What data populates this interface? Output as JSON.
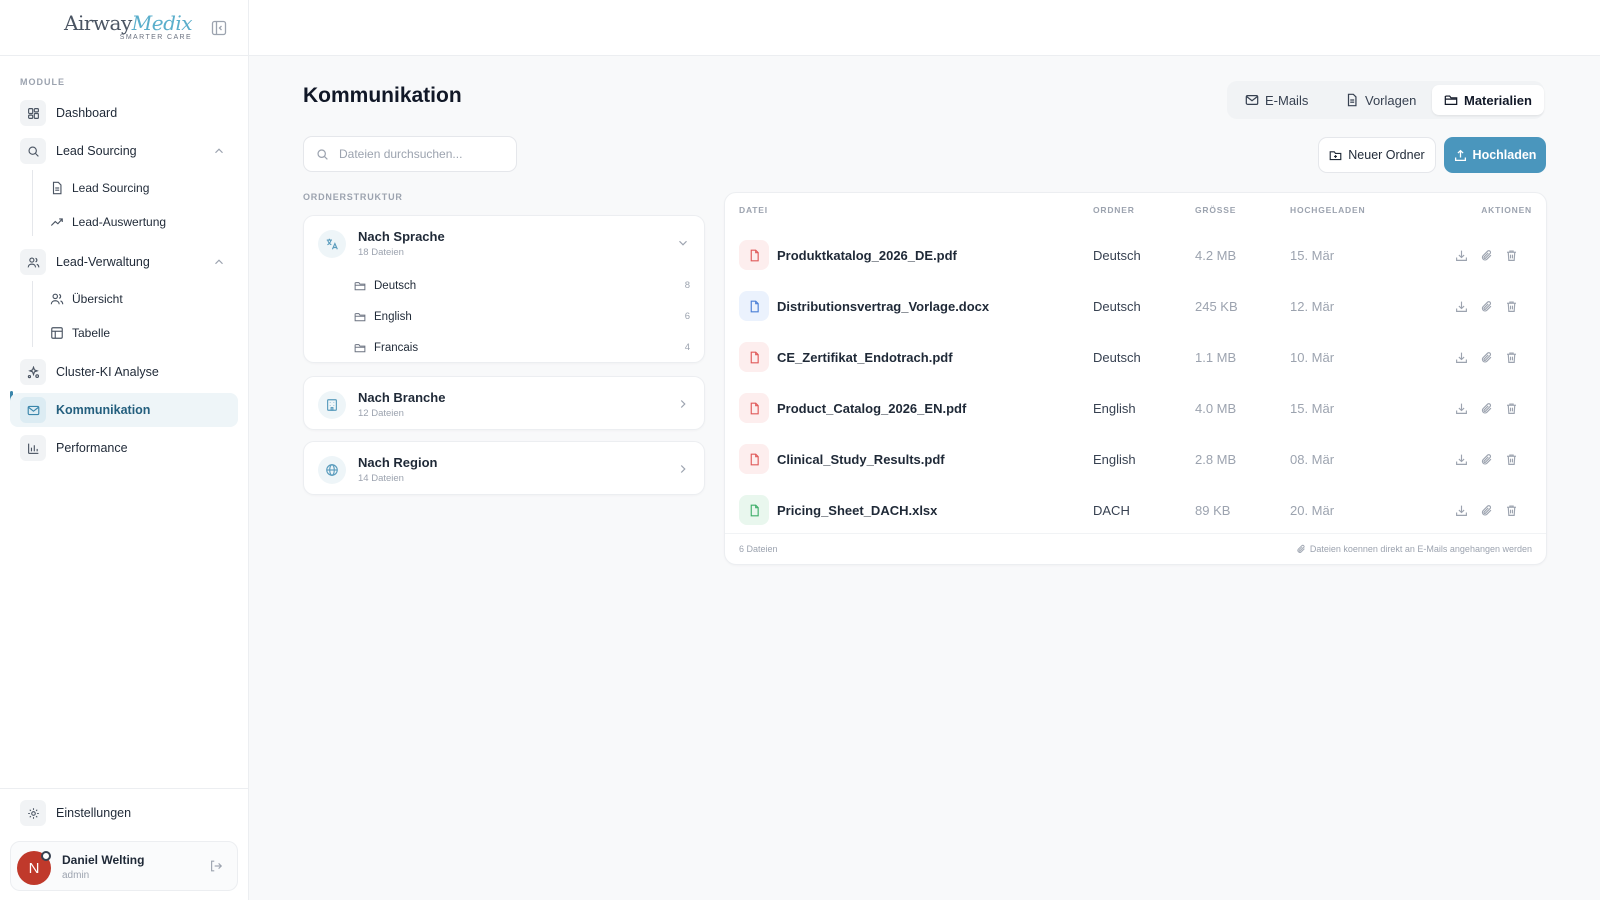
{
  "brand": {
    "name_part1": "Airway",
    "name_part2": "Medix",
    "tagline": "SMARTER CARE"
  },
  "sidebar": {
    "section_label": "MODULE",
    "items": [
      {
        "label": "Dashboard",
        "icon": "dashboard-icon"
      },
      {
        "label": "Lead Sourcing",
        "icon": "search-icon",
        "expanded": true,
        "children": [
          {
            "label": "Lead Sourcing",
            "icon": "document-icon"
          },
          {
            "label": "Lead-Auswertung",
            "icon": "trend-icon"
          }
        ]
      },
      {
        "label": "Lead-Verwaltung",
        "icon": "users-icon",
        "expanded": true,
        "children": [
          {
            "label": "Übersicht",
            "icon": "users-icon"
          },
          {
            "label": "Tabelle",
            "icon": "table-icon"
          }
        ]
      },
      {
        "label": "Cluster-KI Analyse",
        "icon": "cluster-icon"
      },
      {
        "label": "Kommunikation",
        "icon": "mail-icon",
        "active": true
      },
      {
        "label": "Performance",
        "icon": "bar-chart-icon"
      }
    ],
    "settings_label": "Einstellungen",
    "user": {
      "initial": "N",
      "name": "Daniel Welting",
      "role": "admin"
    }
  },
  "main": {
    "title": "Kommunikation",
    "tabs": [
      {
        "label": "E-Mails",
        "icon": "mail-icon",
        "active": false
      },
      {
        "label": "Vorlagen",
        "icon": "document-icon",
        "active": false
      },
      {
        "label": "Materialien",
        "icon": "folder-icon",
        "active": true
      }
    ],
    "search": {
      "placeholder": "Dateien durchsuchen...",
      "value": ""
    },
    "new_folder_label": "Neuer Ordner",
    "upload_label": "Hochladen",
    "folder_structure_label": "ORDNERSTRUKTUR",
    "folders": [
      {
        "title": "Nach Sprache",
        "subtitle": "18 Dateien",
        "icon": "translate-icon",
        "expanded": true,
        "children": [
          {
            "label": "Deutsch",
            "count": "8"
          },
          {
            "label": "English",
            "count": "6"
          },
          {
            "label": "Francais",
            "count": "4"
          }
        ]
      },
      {
        "title": "Nach Branche",
        "subtitle": "12 Dateien",
        "icon": "building-icon",
        "expanded": false
      },
      {
        "title": "Nach Region",
        "subtitle": "14 Dateien",
        "icon": "globe-icon",
        "expanded": false
      }
    ],
    "table": {
      "headers": {
        "file": "DATEI",
        "folder": "ORDNER",
        "size": "GRÖSSE",
        "uploaded": "HOCHGELADEN",
        "actions": "AKTIONEN"
      },
      "rows": [
        {
          "name": "Produktkatalog_2026_DE.pdf",
          "type": "pdf",
          "folder": "Deutsch",
          "size": "4.2 MB",
          "date": "15. Mär"
        },
        {
          "name": "Distributionsvertrag_Vorlage.docx",
          "type": "doc",
          "folder": "Deutsch",
          "size": "245 KB",
          "date": "12. Mär"
        },
        {
          "name": "CE_Zertifikat_Endotrach.pdf",
          "type": "pdf",
          "folder": "Deutsch",
          "size": "1.1 MB",
          "date": "10. Mär"
        },
        {
          "name": "Product_Catalog_2026_EN.pdf",
          "type": "pdf",
          "folder": "English",
          "size": "4.0 MB",
          "date": "15. Mär"
        },
        {
          "name": "Clinical_Study_Results.pdf",
          "type": "pdf",
          "folder": "English",
          "size": "2.8 MB",
          "date": "08. Mär"
        },
        {
          "name": "Pricing_Sheet_DACH.xlsx",
          "type": "xls",
          "folder": "DACH",
          "size": "89 KB",
          "date": "20. Mär"
        }
      ],
      "footer_count": "6 Dateien",
      "footer_hint": "Dateien koennen direkt an E-Mails angehangen werden"
    }
  },
  "colors": {
    "accent": "#4a96bd",
    "active_bg": "#eef5f8",
    "pdf": "#e05a5a",
    "doc": "#4b7fd6",
    "xls": "#3fae6a"
  }
}
